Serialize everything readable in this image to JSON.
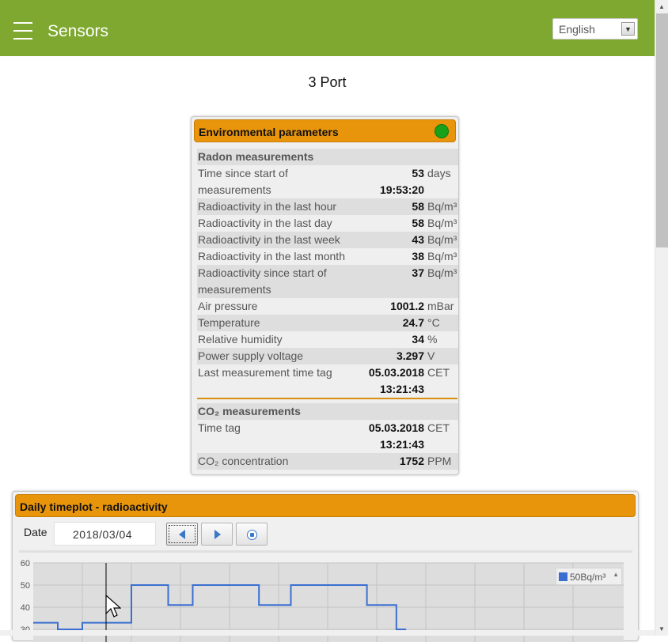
{
  "header": {
    "title": "Sensors",
    "menu_icon": "hamburger-menu-icon",
    "language": "English"
  },
  "page_title": "3 Port",
  "env_card": {
    "title": "Environmental parameters",
    "status_color": "#1aa11a",
    "radon_section": "Radon measurements",
    "rows": [
      {
        "label": "Time since start of",
        "value": "53",
        "unit": "days"
      },
      {
        "label": "measurements",
        "value": "19:53:20",
        "unit": ""
      },
      {
        "label": "Radioactivity in the last hour",
        "value": "58",
        "unit": "Bq/m³"
      },
      {
        "label": "Radioactivity in the last day",
        "value": "58",
        "unit": "Bq/m³"
      },
      {
        "label": "Radioactivity in the last week",
        "value": "43",
        "unit": "Bq/m³"
      },
      {
        "label": "Radioactivity in the last month",
        "value": "38",
        "unit": "Bq/m³"
      },
      {
        "label": "Radioactivity since start of",
        "value": "37",
        "unit": "Bq/m³"
      },
      {
        "label": "measurements",
        "value": "",
        "unit": ""
      },
      {
        "label": "Air pressure",
        "value": "1001.2",
        "unit": "mBar"
      },
      {
        "label": "Temperature",
        "value": "24.7",
        "unit": "°C"
      },
      {
        "label": "Relative humidity",
        "value": "34",
        "unit": "%"
      },
      {
        "label": "Power supply voltage",
        "value": "3.297",
        "unit": "V"
      },
      {
        "label": "Last measurement time tag",
        "value": "05.03.2018",
        "unit": "CET"
      },
      {
        "label": "",
        "value": "13:21:43",
        "unit": ""
      }
    ],
    "co2_section": "CO₂ measurements",
    "co2_rows": [
      {
        "label": "Time tag",
        "value": "05.03.2018",
        "unit": "CET"
      },
      {
        "label": "",
        "value": "13:21:43",
        "unit": ""
      },
      {
        "label": "CO₂ concentration",
        "value": "1752",
        "unit": "PPM"
      }
    ]
  },
  "chart_card": {
    "title": "Daily timeplot - radioactivity",
    "date_label": "Date",
    "date_value": "2018/03/04",
    "prev_icon": "arrow-left-icon",
    "next_icon": "arrow-right-icon",
    "stop_icon": "stop-icon",
    "legend_label": "50Bq/m³"
  },
  "chart_data": {
    "type": "line",
    "title": "",
    "xlabel": "",
    "ylabel": "",
    "ylim": [
      30,
      60
    ],
    "yticks": [
      "60",
      "50",
      "40",
      "30"
    ],
    "grid": true,
    "series_color": "#3a6fd0",
    "legend_placement": "top-right",
    "series": [
      {
        "name": "50Bq/m³",
        "x": [
          0,
          1,
          1,
          2,
          2,
          3,
          3,
          4,
          4,
          4.5,
          4.5,
          5.5,
          5.5,
          6.5,
          6.5,
          7.5,
          7.5,
          9.2,
          9.2,
          10.5,
          10.5,
          11.7,
          11.7,
          13.6,
          13.6,
          14.8,
          14.8,
          15.2
        ],
        "values": [
          33,
          33,
          30,
          30,
          33,
          33,
          33,
          33,
          50,
          50,
          50,
          50,
          41,
          41,
          50,
          50,
          50,
          50,
          41,
          41,
          50,
          50,
          50,
          50,
          41,
          41,
          30,
          30
        ]
      }
    ]
  }
}
